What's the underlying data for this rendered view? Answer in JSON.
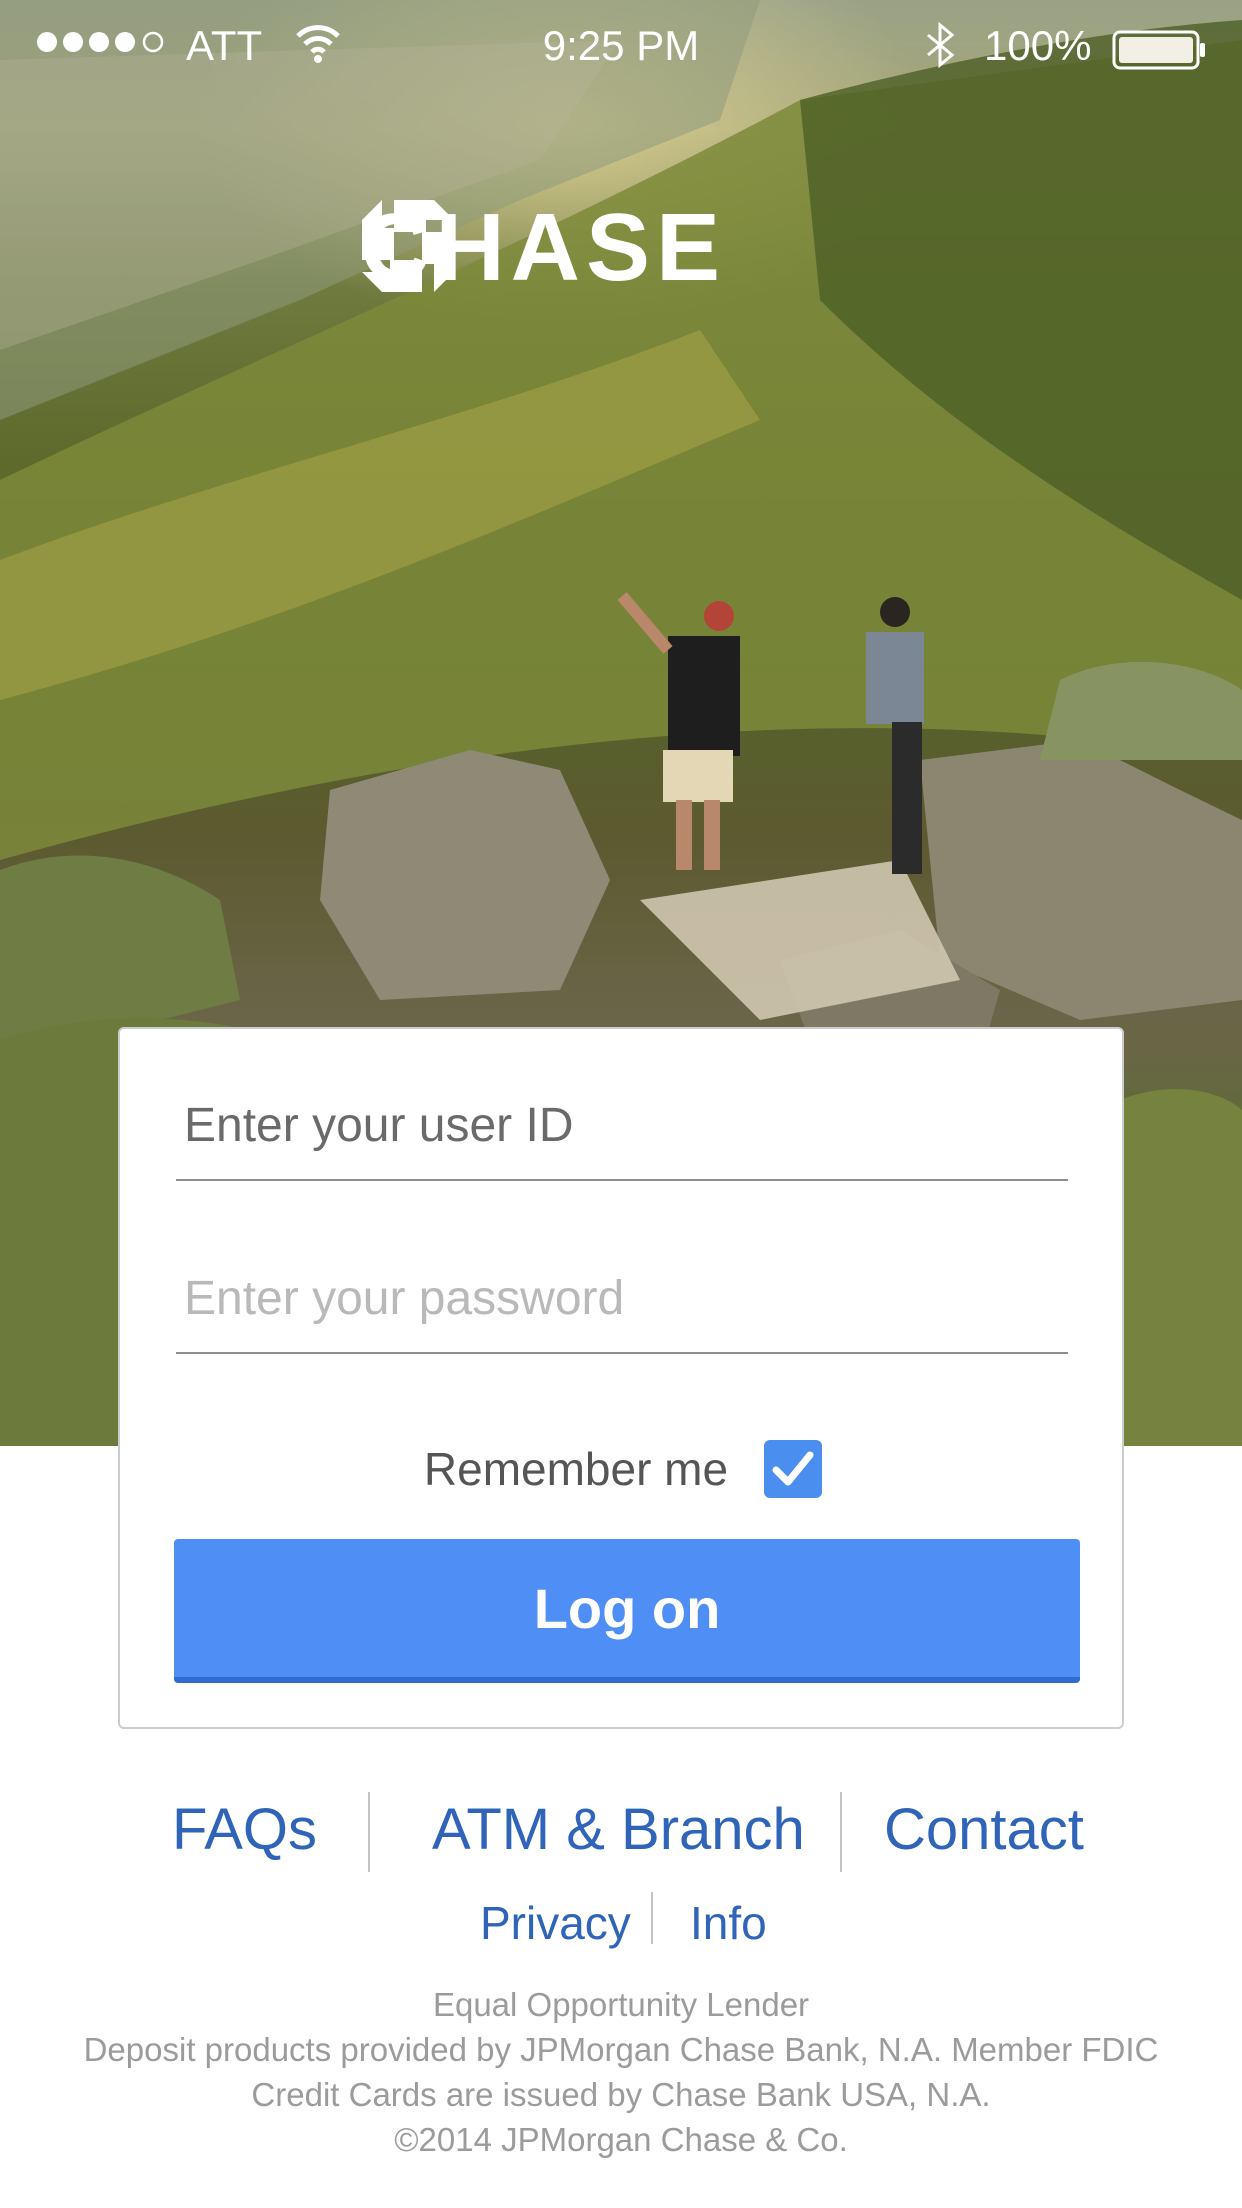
{
  "status_bar": {
    "carrier": "ATT",
    "time": "9:25 PM",
    "battery": "100%",
    "signal_icon": "signal-dots-icon",
    "wifi_icon": "wifi-icon",
    "bluetooth_icon": "bluetooth-icon",
    "battery_icon": "battery-icon"
  },
  "brand": {
    "name": "CHASE",
    "logo_icon": "chase-octagon-icon"
  },
  "login_form": {
    "user_id_placeholder": "Enter your user ID",
    "password_placeholder": "Enter your password",
    "remember_label": "Remember me",
    "remember_checked": true,
    "submit_label": "Log on"
  },
  "links": {
    "faqs": "FAQs",
    "atm_branch": "ATM & Branch",
    "contact": "Contact",
    "privacy": "Privacy",
    "info": "Info"
  },
  "footer": {
    "line1": "Equal Opportunity Lender",
    "line2": "Deposit products provided by JPMorgan Chase Bank, N.A. Member FDIC",
    "line3": "Credit Cards are issued by Chase Bank USA, N.A.",
    "line4": "©2014 JPMorgan Chase & Co."
  },
  "colors": {
    "accent": "#4f8ef5",
    "link": "#2f64b8",
    "footer_text": "#9b9b9b",
    "card_border": "#c9ccd1"
  }
}
